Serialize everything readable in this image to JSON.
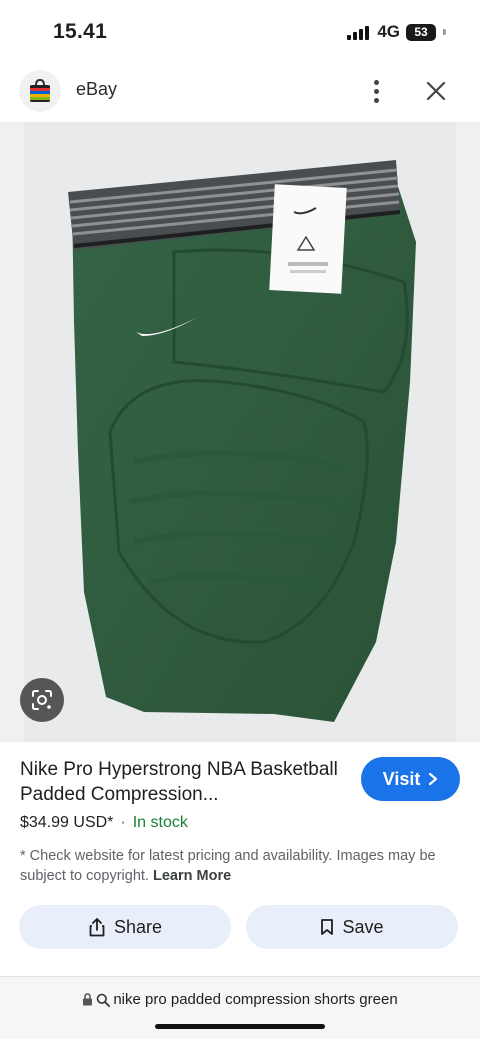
{
  "status": {
    "time": "15.41",
    "network": "4G",
    "battery": "53"
  },
  "header": {
    "site_name": "eBay",
    "more_icon": "more-vertical-icon",
    "close_icon": "close-icon"
  },
  "product": {
    "title": "Nike Pro Hyperstrong NBA Basketball Padded Compression...",
    "price": "$34.99 USD*",
    "separator": "·",
    "stock": "In stock",
    "disclaimer": "* Check website for latest pricing and availability. Images may be subject to copyright.",
    "learn_more": "Learn More",
    "image_subject": "green padded compression shorts"
  },
  "actions": {
    "visit_label": "Visit",
    "share_label": "Share",
    "save_label": "Save"
  },
  "url_bar": {
    "query": "nike pro padded compression shorts green"
  },
  "colors": {
    "accent": "#1a73e8",
    "in_stock": "#188038",
    "button_bg": "#e8effb",
    "shorts_green": "#2e5a3c"
  }
}
